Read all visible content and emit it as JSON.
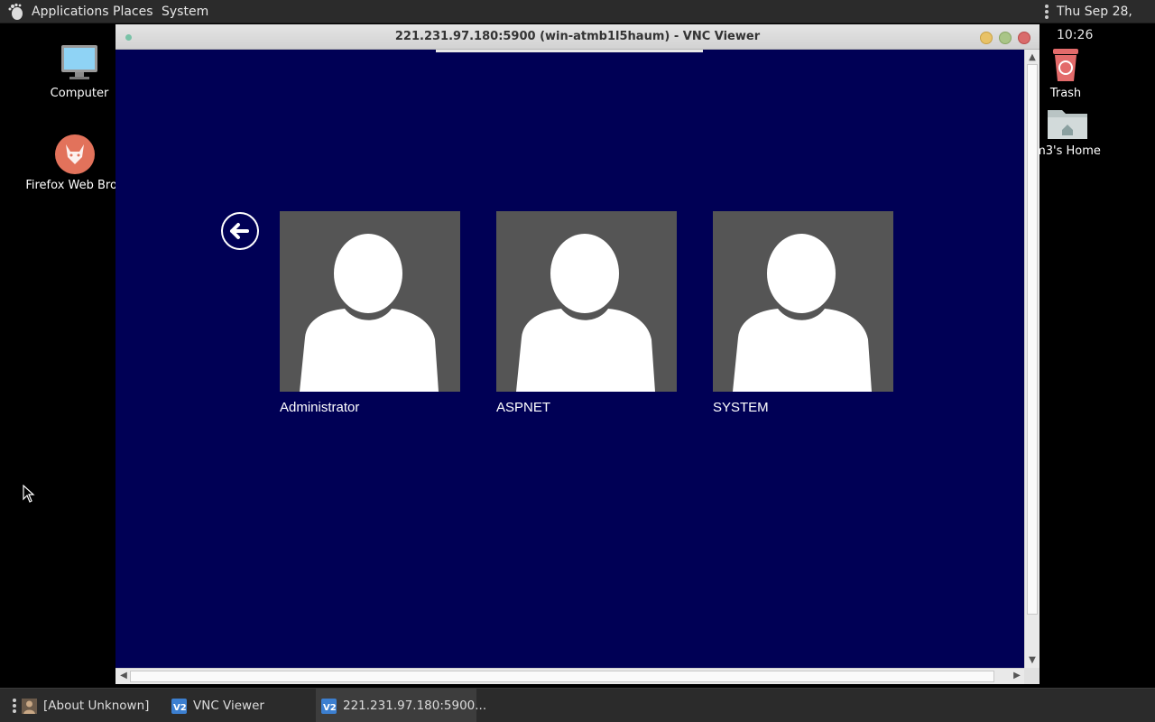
{
  "top_panel": {
    "menus": [
      "Applications",
      "Places",
      "System"
    ],
    "clock": "Thu Sep 28, 10:26"
  },
  "desktop": {
    "icons": [
      {
        "label": "Computer",
        "icon": "computer-icon"
      },
      {
        "label": "Firefox Web Brov",
        "icon": "firefox-icon"
      },
      {
        "label": "Trash",
        "icon": "trash-icon"
      },
      {
        "label": "m3's Home",
        "icon": "home-folder-icon"
      }
    ]
  },
  "vnc_window": {
    "title": "221.231.97.180:5900 (win-atmb1l5haum) - VNC Viewer",
    "remote": {
      "background": "#000055",
      "users": [
        {
          "name": "Administrator"
        },
        {
          "name": "ASPNET"
        },
        {
          "name": "SYSTEM"
        }
      ]
    }
  },
  "taskbar": {
    "tasks": [
      {
        "label": "[About Unknown]",
        "icon": "user-icon"
      },
      {
        "label": "VNC Viewer",
        "icon": "vnc-icon"
      },
      {
        "label": "221.231.97.180:5900...",
        "icon": "vnc-icon",
        "active": true
      }
    ]
  }
}
